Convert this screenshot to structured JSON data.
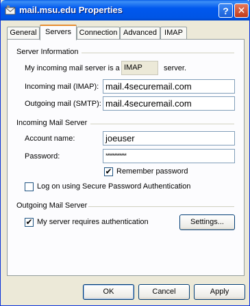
{
  "window": {
    "title": "mail.msu.edu Properties",
    "help_glyph": "?",
    "close_glyph": "✕"
  },
  "tabs": [
    {
      "label": "General"
    },
    {
      "label": "Servers"
    },
    {
      "label": "Connection"
    },
    {
      "label": "Advanced"
    },
    {
      "label": "IMAP"
    }
  ],
  "active_tab": "Servers",
  "server_info": {
    "heading": "Server Information",
    "incoming_prefix": "My incoming mail server is a",
    "server_type": "IMAP",
    "incoming_suffix": "server.",
    "incoming_label": "Incoming mail (IMAP):",
    "incoming_value": "mail.4securemail.com",
    "outgoing_label": "Outgoing mail (SMTP):",
    "outgoing_value": "mail.4securemail.com"
  },
  "incoming_server": {
    "heading": "Incoming Mail Server",
    "account_label": "Account name:",
    "account_value": "joeuser",
    "password_label": "Password:",
    "password_value": "************",
    "remember_label": "Remember password",
    "remember_checked": true,
    "spa_label": "Log on using Secure Password Authentication",
    "spa_checked": false
  },
  "outgoing_server": {
    "heading": "Outgoing Mail Server",
    "auth_label": "My server requires authentication",
    "auth_checked": true,
    "settings_label": "Settings..."
  },
  "buttons": {
    "ok": "OK",
    "cancel": "Cancel",
    "apply": "Apply"
  }
}
